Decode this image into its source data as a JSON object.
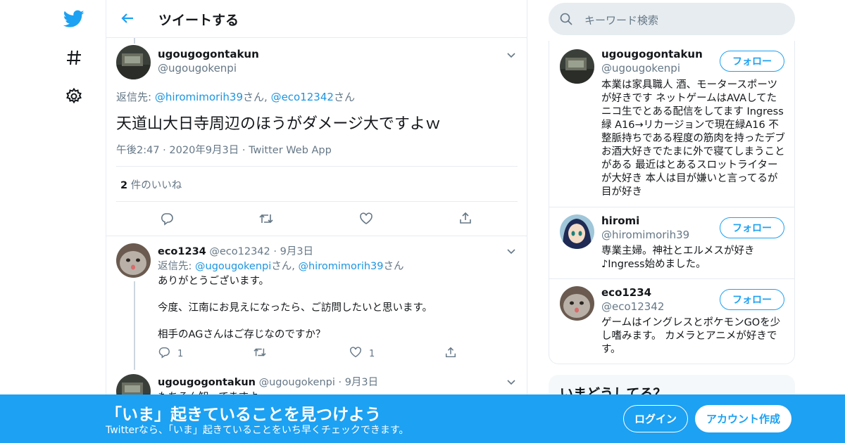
{
  "header": {
    "title": "ツイートする"
  },
  "focus_tweet": {
    "name": "ugougogontakun",
    "handle": "@ugougokenpi",
    "reply_prefix": "返信先: ",
    "reply_to_1": "@hiromimorih39",
    "reply_sep_1": "さん, ",
    "reply_to_2": "@eco12342",
    "reply_sep_2": "さん",
    "text": "天道山大日寺周辺のほうがダメージ大ですよｗ",
    "time": "午後2:47",
    "date": "2020年9月3日",
    "source": "Twitter Web App",
    "likes_count": "2",
    "likes_label": "件のいいね"
  },
  "replies": [
    {
      "name": "eco1234",
      "handle": "@eco12342",
      "date": "9月3日",
      "reply_prefix": "返信先: ",
      "reply_to_1": "@ugougokenpi",
      "reply_sep_1": "さん, ",
      "reply_to_2": "@hiromimorih39",
      "reply_sep_2": "さん",
      "line1": "ありがとうございます。",
      "line2": "今度、江南にお見えになったら、ご訪問したいと思います。",
      "line3": "相手のAGさんはご存じなのですか？",
      "reply_count": "1",
      "like_count": "1"
    },
    {
      "name": "ugougogontakun",
      "handle": "@ugougokenpi",
      "date": "9月3日",
      "text": "もちろん知ってますよ"
    }
  ],
  "search": {
    "placeholder": "キーワード検索"
  },
  "users": [
    {
      "name": "ugougogontakun",
      "handle": "@ugougokenpi",
      "follow": "フォロー",
      "bio": "本業は家具職人 酒、モータースポーツが好きです ネットゲームはAVAしてた ニコ生でとある配信をしてます Ingress 緑 A16→リカージョンで現在緑A16 不整脈持ちである程度の筋肉を持ったデブ お酒大好きでたまに外で寝てしまうことがある 最近はとあるスロットライターが大好き 本人は目が嫌いと言ってるが目が好き"
    },
    {
      "name": "hiromi",
      "handle": "@hiromimorih39",
      "follow": "フォロー",
      "bio": "専業主婦。神社とエルメスが好き♪Ingress始めました。"
    },
    {
      "name": "eco1234",
      "handle": "@eco12342",
      "follow": "フォロー",
      "bio": "ゲームはイングレスとポケモンGOを少し嗜みます。 カメラとアニメが好きです。"
    }
  ],
  "trends": {
    "title": "いまどうしてる？"
  },
  "banner": {
    "headline": "「いま」起きていることを見つけよう",
    "sub": "Twitterなら、「いま」起きていることをいち早くチェックできます。",
    "login": "ログイン",
    "signup": "アカウント作成"
  },
  "colors": {
    "brand": "#1da1f2",
    "link": "#1b95e0",
    "muted": "#657786"
  },
  "icons": [
    "twitter-logo-icon",
    "hashtag-icon",
    "gear-icon",
    "back-arrow-icon",
    "chevron-down-icon",
    "reply-icon",
    "retweet-icon",
    "like-icon",
    "share-icon",
    "search-icon"
  ]
}
